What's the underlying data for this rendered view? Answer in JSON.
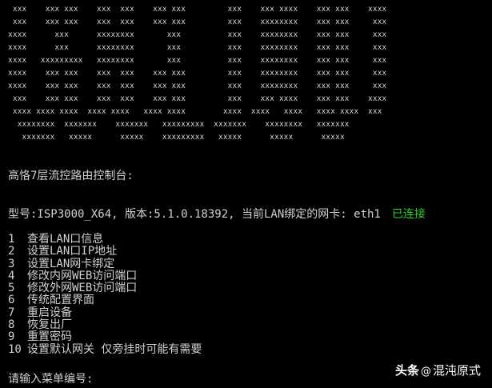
{
  "banner": {
    "lines": [
      " xxx    xxx xxx    xxx  xxx    xxx xxx         xxx    xxx xxxx    xxx xxx    xxxx",
      " xxx    xxx xxx    xxx  xxx    xxx xxx         xxx    xxxxxxxx    xxx xxx     xxx",
      "xxxx      xxx      xxxxxxxx       xxx          xxx    xxxxxxxx    xxx xxx     xxx",
      "xxxx      xxx      xxxxxxxx       xxx          xxx    xxxxxxxx    xxx xxx     xxx",
      "xxxx   xxxxxxxxx   xxxxxxxx       xxx          xxx    xxxxxxxx    xxx xxx     xxx",
      "xxxx    xxx xxx    xxx  xxx    xxx xxx         xxx    xxxxxxxx    xxx xxx     xxx",
      "xxxx    xxx xxx    xxx  xxx    xxx xxx         xxx    xxxxxxxx    xxx xxx     xxx",
      " xxx    xxx xxx    xxx  xxx    xxx xxx         xxx    xxx xxxx    xxx xxx    xxxx",
      " xxxx xxxx xxxx  xxxx xxxx   xxxx xxxx        xxxx  xxxx   xxxx   xxxx xxxx  xxx",
      "  xxxxxxxx  xxxxxxx    xxxxxxx   xxxxxxxxx  xxxxxxx    xxxxxxxx   xxxxxxx",
      "   xxxxxxx   xxxxx      xxxxx    xxxxxxxxx   xxxxx      xxxxx      xxxxx"
    ]
  },
  "console_title": "高恪7层流控路由控制台:",
  "status": {
    "text": "型号:ISP3000_X64, 版本:5.1.0.18392, 当前LAN绑定的网卡: eth1",
    "connection": "已连接",
    "connection_color": "#33cc33"
  },
  "menu": [
    {
      "num": "1",
      "label": "查看LAN口信息"
    },
    {
      "num": "2",
      "label": "设置LAN口IP地址"
    },
    {
      "num": "3",
      "label": "设置LAN网卡绑定"
    },
    {
      "num": "4",
      "label": "修改内网WEB访问端口"
    },
    {
      "num": "5",
      "label": "修改外网WEB访问端口"
    },
    {
      "num": "6",
      "label": "传统配置界面"
    },
    {
      "num": "7",
      "label": "重启设备"
    },
    {
      "num": "8",
      "label": "恢复出厂"
    },
    {
      "num": "9",
      "label": "重置密码"
    },
    {
      "num": "10",
      "label": "设置默认网关 仅旁挂时可能有需要"
    }
  ],
  "prompt": "请输入菜单编号:",
  "watermark": {
    "brand": "头条",
    "separator": "@",
    "author": "混沌原式",
    "icon": "at-icon"
  }
}
